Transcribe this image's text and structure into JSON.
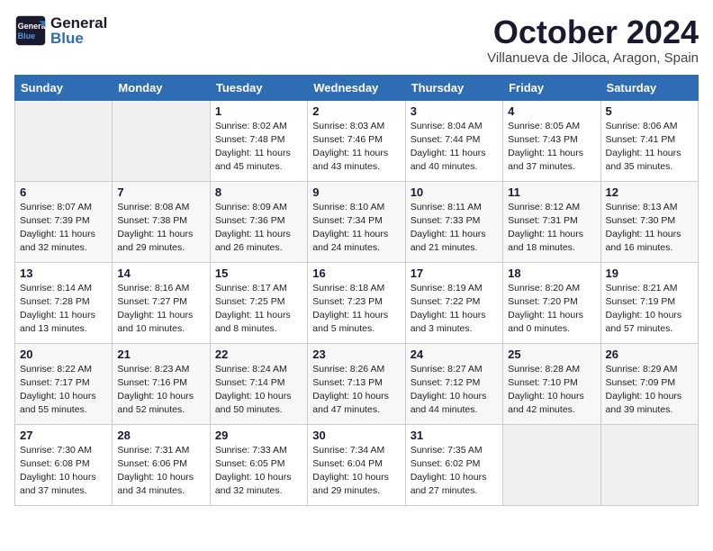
{
  "header": {
    "logo_general": "General",
    "logo_blue": "Blue",
    "month": "October 2024",
    "location": "Villanueva de Jiloca, Aragon, Spain"
  },
  "days_of_week": [
    "Sunday",
    "Monday",
    "Tuesday",
    "Wednesday",
    "Thursday",
    "Friday",
    "Saturday"
  ],
  "weeks": [
    [
      {
        "day": "",
        "detail": ""
      },
      {
        "day": "",
        "detail": ""
      },
      {
        "day": "1",
        "detail": "Sunrise: 8:02 AM\nSunset: 7:48 PM\nDaylight: 11 hours and 45 minutes."
      },
      {
        "day": "2",
        "detail": "Sunrise: 8:03 AM\nSunset: 7:46 PM\nDaylight: 11 hours and 43 minutes."
      },
      {
        "day": "3",
        "detail": "Sunrise: 8:04 AM\nSunset: 7:44 PM\nDaylight: 11 hours and 40 minutes."
      },
      {
        "day": "4",
        "detail": "Sunrise: 8:05 AM\nSunset: 7:43 PM\nDaylight: 11 hours and 37 minutes."
      },
      {
        "day": "5",
        "detail": "Sunrise: 8:06 AM\nSunset: 7:41 PM\nDaylight: 11 hours and 35 minutes."
      }
    ],
    [
      {
        "day": "6",
        "detail": "Sunrise: 8:07 AM\nSunset: 7:39 PM\nDaylight: 11 hours and 32 minutes."
      },
      {
        "day": "7",
        "detail": "Sunrise: 8:08 AM\nSunset: 7:38 PM\nDaylight: 11 hours and 29 minutes."
      },
      {
        "day": "8",
        "detail": "Sunrise: 8:09 AM\nSunset: 7:36 PM\nDaylight: 11 hours and 26 minutes."
      },
      {
        "day": "9",
        "detail": "Sunrise: 8:10 AM\nSunset: 7:34 PM\nDaylight: 11 hours and 24 minutes."
      },
      {
        "day": "10",
        "detail": "Sunrise: 8:11 AM\nSunset: 7:33 PM\nDaylight: 11 hours and 21 minutes."
      },
      {
        "day": "11",
        "detail": "Sunrise: 8:12 AM\nSunset: 7:31 PM\nDaylight: 11 hours and 18 minutes."
      },
      {
        "day": "12",
        "detail": "Sunrise: 8:13 AM\nSunset: 7:30 PM\nDaylight: 11 hours and 16 minutes."
      }
    ],
    [
      {
        "day": "13",
        "detail": "Sunrise: 8:14 AM\nSunset: 7:28 PM\nDaylight: 11 hours and 13 minutes."
      },
      {
        "day": "14",
        "detail": "Sunrise: 8:16 AM\nSunset: 7:27 PM\nDaylight: 11 hours and 10 minutes."
      },
      {
        "day": "15",
        "detail": "Sunrise: 8:17 AM\nSunset: 7:25 PM\nDaylight: 11 hours and 8 minutes."
      },
      {
        "day": "16",
        "detail": "Sunrise: 8:18 AM\nSunset: 7:23 PM\nDaylight: 11 hours and 5 minutes."
      },
      {
        "day": "17",
        "detail": "Sunrise: 8:19 AM\nSunset: 7:22 PM\nDaylight: 11 hours and 3 minutes."
      },
      {
        "day": "18",
        "detail": "Sunrise: 8:20 AM\nSunset: 7:20 PM\nDaylight: 11 hours and 0 minutes."
      },
      {
        "day": "19",
        "detail": "Sunrise: 8:21 AM\nSunset: 7:19 PM\nDaylight: 10 hours and 57 minutes."
      }
    ],
    [
      {
        "day": "20",
        "detail": "Sunrise: 8:22 AM\nSunset: 7:17 PM\nDaylight: 10 hours and 55 minutes."
      },
      {
        "day": "21",
        "detail": "Sunrise: 8:23 AM\nSunset: 7:16 PM\nDaylight: 10 hours and 52 minutes."
      },
      {
        "day": "22",
        "detail": "Sunrise: 8:24 AM\nSunset: 7:14 PM\nDaylight: 10 hours and 50 minutes."
      },
      {
        "day": "23",
        "detail": "Sunrise: 8:26 AM\nSunset: 7:13 PM\nDaylight: 10 hours and 47 minutes."
      },
      {
        "day": "24",
        "detail": "Sunrise: 8:27 AM\nSunset: 7:12 PM\nDaylight: 10 hours and 44 minutes."
      },
      {
        "day": "25",
        "detail": "Sunrise: 8:28 AM\nSunset: 7:10 PM\nDaylight: 10 hours and 42 minutes."
      },
      {
        "day": "26",
        "detail": "Sunrise: 8:29 AM\nSunset: 7:09 PM\nDaylight: 10 hours and 39 minutes."
      }
    ],
    [
      {
        "day": "27",
        "detail": "Sunrise: 7:30 AM\nSunset: 6:08 PM\nDaylight: 10 hours and 37 minutes."
      },
      {
        "day": "28",
        "detail": "Sunrise: 7:31 AM\nSunset: 6:06 PM\nDaylight: 10 hours and 34 minutes."
      },
      {
        "day": "29",
        "detail": "Sunrise: 7:33 AM\nSunset: 6:05 PM\nDaylight: 10 hours and 32 minutes."
      },
      {
        "day": "30",
        "detail": "Sunrise: 7:34 AM\nSunset: 6:04 PM\nDaylight: 10 hours and 29 minutes."
      },
      {
        "day": "31",
        "detail": "Sunrise: 7:35 AM\nSunset: 6:02 PM\nDaylight: 10 hours and 27 minutes."
      },
      {
        "day": "",
        "detail": ""
      },
      {
        "day": "",
        "detail": ""
      }
    ]
  ]
}
